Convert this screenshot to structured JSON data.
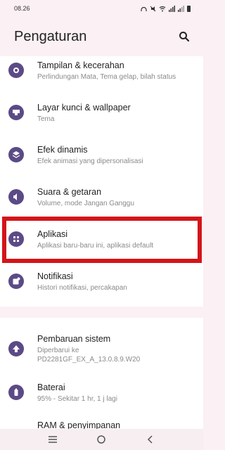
{
  "status": {
    "time": "08.26",
    "icons": "∩ × ≈ ▐ ▐"
  },
  "header": {
    "title": "Pengaturan",
    "search_icon": "search-icon"
  },
  "settings": [
    {
      "label": "Tampilan & kecerahan",
      "sub": "Perlindungan Mata, Tema gelap, bilah status",
      "icon": "display-brightness-icon"
    },
    {
      "label": "Layar kunci & wallpaper",
      "sub": "Tema",
      "icon": "wallpaper-icon"
    },
    {
      "label": "Efek dinamis",
      "sub": "Efek animasi yang dipersonalisasi",
      "icon": "dynamic-effects-icon"
    },
    {
      "label": "Suara & getaran",
      "sub": "Volume, mode Jangan Ganggu",
      "icon": "speaker-icon"
    },
    {
      "label": "Aplikasi",
      "sub": "Aplikasi baru-baru ini, aplikasi default",
      "icon": "apps-grid-icon"
    },
    {
      "label": "Notifikasi",
      "sub": "Histori notifikasi, percakapan",
      "icon": "notification-icon"
    }
  ],
  "settings2": [
    {
      "label": "Pembaruan sistem",
      "sub": "Diperbarui ke",
      "sub2": "PD2281GF_EX_A_13.0.8.9.W20",
      "icon": "system-update-icon"
    },
    {
      "label": "Baterai",
      "sub": "95% - Sekitar 1 hr, 1 j lagi",
      "icon": "battery-icon"
    }
  ],
  "cutoff_label": "RAM & penyimpanan",
  "colors": {
    "accent": "#5c4a86",
    "highlight": "#d4141a",
    "background": "#fbf0f3"
  },
  "nav": {
    "menu_icon": "menu-icon",
    "home_icon": "home-icon",
    "back_icon": "back-icon"
  }
}
